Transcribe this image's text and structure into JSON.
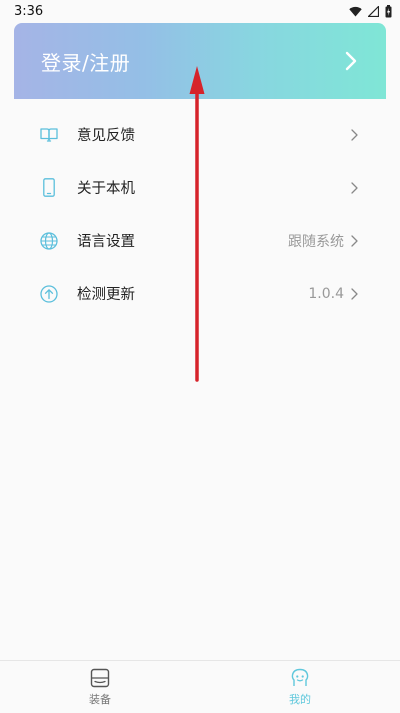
{
  "status_bar": {
    "time": "3:36"
  },
  "login": {
    "label": "登录/注册"
  },
  "menu": {
    "items": [
      {
        "label": "意见反馈",
        "value": "",
        "icon": "feedback-book-icon"
      },
      {
        "label": "关于本机",
        "value": "",
        "icon": "phone-icon"
      },
      {
        "label": "语言设置",
        "value": "跟随系统",
        "icon": "globe-icon"
      },
      {
        "label": "检测更新",
        "value": "1.0.4",
        "icon": "upload-circle-icon"
      }
    ]
  },
  "bottom_nav": {
    "tabs": [
      {
        "label": "装备",
        "icon": "device-icon",
        "active": false
      },
      {
        "label": "我的",
        "icon": "profile-head-icon",
        "active": true
      }
    ]
  },
  "colors": {
    "accent": "#5fc8dc",
    "icon": "#5bbfdc",
    "annotation_arrow": "#d6232a",
    "banner_gradient": [
      "#a5b4e6",
      "#7fe6d6"
    ]
  }
}
